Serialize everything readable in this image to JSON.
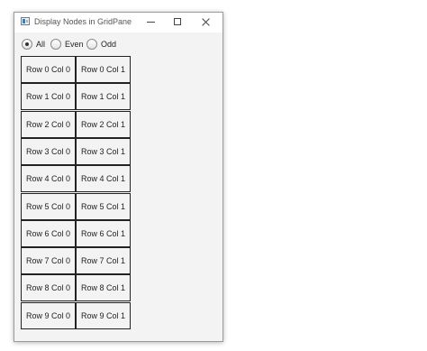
{
  "window": {
    "title": "Display Nodes in GridPane",
    "app_icon": "java-app-icon",
    "controls": {
      "minimize_icon": "minimize-icon",
      "maximize_icon": "maximize-icon",
      "close_icon": "close-icon"
    }
  },
  "radio_group": {
    "options": [
      {
        "label": "All",
        "checked": true
      },
      {
        "label": "Even",
        "checked": false
      },
      {
        "label": "Odd",
        "checked": false
      }
    ]
  },
  "grid": {
    "cells": [
      [
        "Row 0 Col 0",
        "Row 0 Col 1"
      ],
      [
        "Row 1 Col 0",
        "Row 1 Col 1"
      ],
      [
        "Row 2 Col 0",
        "Row 2 Col 1"
      ],
      [
        "Row 3 Col 0",
        "Row 3 Col 1"
      ],
      [
        "Row 4 Col 0",
        "Row 4 Col 1"
      ],
      [
        "Row 5 Col 0",
        "Row 5 Col 1"
      ],
      [
        "Row 6 Col 0",
        "Row 6 Col 1"
      ],
      [
        "Row 7 Col 0",
        "Row 7 Col 1"
      ],
      [
        "Row 8 Col 0",
        "Row 8 Col 1"
      ],
      [
        "Row 9 Col 0",
        "Row 9 Col 1"
      ]
    ]
  }
}
